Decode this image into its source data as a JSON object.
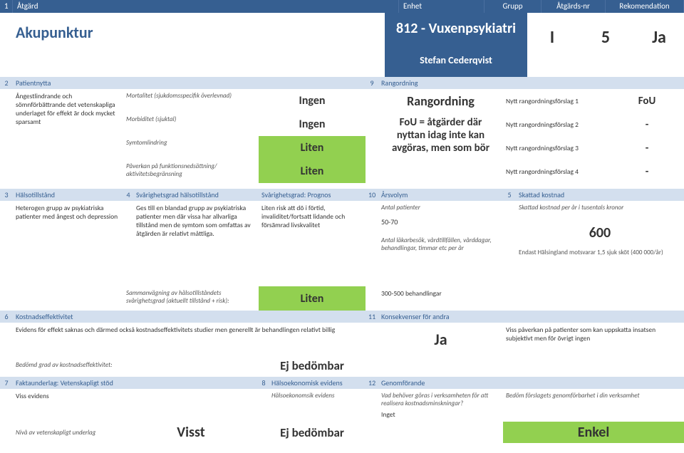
{
  "header": {
    "n1": "1",
    "atgard": "Åtgärd",
    "enhet": "Enhet",
    "grupp": "Grupp",
    "atgardsnr": "Åtgärds-nr",
    "rekomendation": "Rekomendation"
  },
  "title": {
    "name": "Akupunktur",
    "unit": "812 - Vuxenpsykiatri",
    "author": "Stefan Cederqvist",
    "grupp": "I",
    "nr": "5",
    "rek": "Ja"
  },
  "s2": {
    "num": "2",
    "label": "Patientnytta",
    "desc": "Ångestlindrande och sömnförbättrande det vetenskapliga underlaget för effekt är dock mycket sparsamt",
    "rows": [
      {
        "lbl": "Mortalitet (sjukdomsspecifik överlevnad)",
        "val": "Ingen",
        "cls": ""
      },
      {
        "lbl": "Morbiditet (sjuktal)",
        "val": "Ingen",
        "cls": ""
      },
      {
        "lbl": "Symtomlindring",
        "val": "Liten",
        "cls": "green"
      },
      {
        "lbl": "Påverkan på funktionsnedsättning/ aktivitetsbegränsning",
        "val": "Liten",
        "cls": "green"
      }
    ]
  },
  "s9": {
    "num": "9",
    "label": "Rangordning",
    "rang_lbl": "Rangordning",
    "fou_text": "FoU = åtgärder där nyttan idag inte kan avgöras, men som bör",
    "rows": [
      {
        "lbl": "Nytt rangordningsförslag 1",
        "val": "FoU"
      },
      {
        "lbl": "Nytt rangordningsförslag 2",
        "val": "-"
      },
      {
        "lbl": "Nytt rangordningsförslag 3",
        "val": "-"
      },
      {
        "lbl": "Nytt rangordningsförslag 4",
        "val": "-"
      }
    ]
  },
  "s3": {
    "num": "3",
    "label": "Hälsotillstånd",
    "desc": "Heterogen grupp av psykiatriska patienter med ångest och depression"
  },
  "s4": {
    "num": "4",
    "label": "Svårighetsgrad hälsotillstånd",
    "desc": "Ges till en blandad grupp av psykiatriska patienter men där vissa har allvarliga tillstånd men de symtom som omfattas av åtgärden är relativt måttliga.",
    "sum_lbl": "Sammanvägning av hälsotillståndets svårighetsgrad (aktuellt tillstånd + risk):",
    "sum_val": "Liten"
  },
  "prognos": {
    "label": "Svårighetsgrad: Prognos",
    "desc": "Liten risk att dö i förtid, invaliditet/fortsatt lidande och försämrad livskvalitet"
  },
  "s10": {
    "num": "10",
    "label": "Årsvolym",
    "ant_lbl": "Antal patienter",
    "ant_val": "50-70",
    "besok_lbl": "Antal läkarbesök, vårdtillfällen, vårddagar, behandlingar, timmar etc per år",
    "besok_val": "300-500 behandlingar"
  },
  "s5": {
    "num": "5",
    "label": "Skattad kostnad",
    "sub": "Skattad kostnad per år i tusentals kronor",
    "val": "600",
    "note": "Endast Hälsingland motsvarar 1,5 sjuk sköt (400 000/år)"
  },
  "s6": {
    "num": "6",
    "label": "Kostnadseffektivitet",
    "desc": "Evidens för effekt saknas och därmed också kostnadseffektivitets studier men generellt är behandlingen relativt billig",
    "grad_lbl": "Bedömd grad av kostnadseffektivitet:",
    "grad_val": "Ej bedömbar"
  },
  "s11": {
    "num": "11",
    "label": "Konsekvenser för andra",
    "val": "Ja",
    "note": "Viss påverkan på patienter som kan uppskatta insatsen subjektivt men för övrigt ingen"
  },
  "s7": {
    "num": "7",
    "label": "Faktaunderlag: Vetenskapligt stöd",
    "desc": "Viss evidens",
    "niv_lbl": "Nivå av vetenskapligt underlag",
    "niv_val": "Visst"
  },
  "s8": {
    "num": "8",
    "label": "Hälsoekonomisk evidens",
    "sub": "Hälsoekonomsik evidens",
    "val": "Ej bedömbar"
  },
  "s12": {
    "num": "12",
    "label": "Genomförande",
    "q": "Vad behöver göras i verksamheten för att realisera kostnadsminskningar?",
    "a": "Inget",
    "r_lbl": "Bedöm förslagets genomförbarhet i din verksamhet",
    "r_val": "Enkel"
  }
}
